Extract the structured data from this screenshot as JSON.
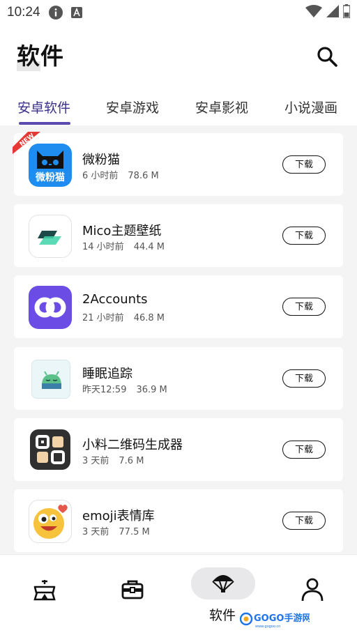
{
  "status_bar": {
    "time": "10:24"
  },
  "header": {
    "title": "软件"
  },
  "tabs": [
    {
      "label": "安卓软件",
      "active": true
    },
    {
      "label": "安卓游戏",
      "active": false
    },
    {
      "label": "安卓影视",
      "active": false
    },
    {
      "label": "小说漫画",
      "active": false
    }
  ],
  "apps": [
    {
      "name": "微粉猫",
      "time": "6 小时前",
      "size": "78.6 M",
      "badge": "NEW",
      "icon_text": "微粉猫",
      "action": "下载"
    },
    {
      "name": "Mico主题壁纸",
      "time": "14 小时前",
      "size": "44.4 M",
      "action": "下载"
    },
    {
      "name": "2Accounts",
      "time": "21 小时前",
      "size": "46.8 M",
      "action": "下载"
    },
    {
      "name": "睡眠追踪",
      "time": "昨天12:59",
      "size": "36.9 M",
      "action": "下载"
    },
    {
      "name": "小料二维码生成器",
      "time": "3 天前",
      "size": "7.6 M",
      "action": "下载"
    },
    {
      "name": "emoji表情库",
      "time": "3 天前",
      "size": "77.5 M",
      "action": "下载"
    }
  ],
  "bottom_nav": {
    "items": [
      {
        "icon": "tent-icon"
      },
      {
        "icon": "briefcase-icon"
      },
      {
        "icon": "parachute-icon",
        "label": "软件",
        "active": true
      },
      {
        "icon": "user-icon"
      }
    ]
  },
  "watermark": {
    "brand": "GOGO手游网",
    "url": "www.gogoo.cn"
  },
  "colors": {
    "accent": "#3a2f8c",
    "indicator": "#5a4bb0",
    "badge_red": "#e53935",
    "watermark_blue": "#1e73e8"
  }
}
